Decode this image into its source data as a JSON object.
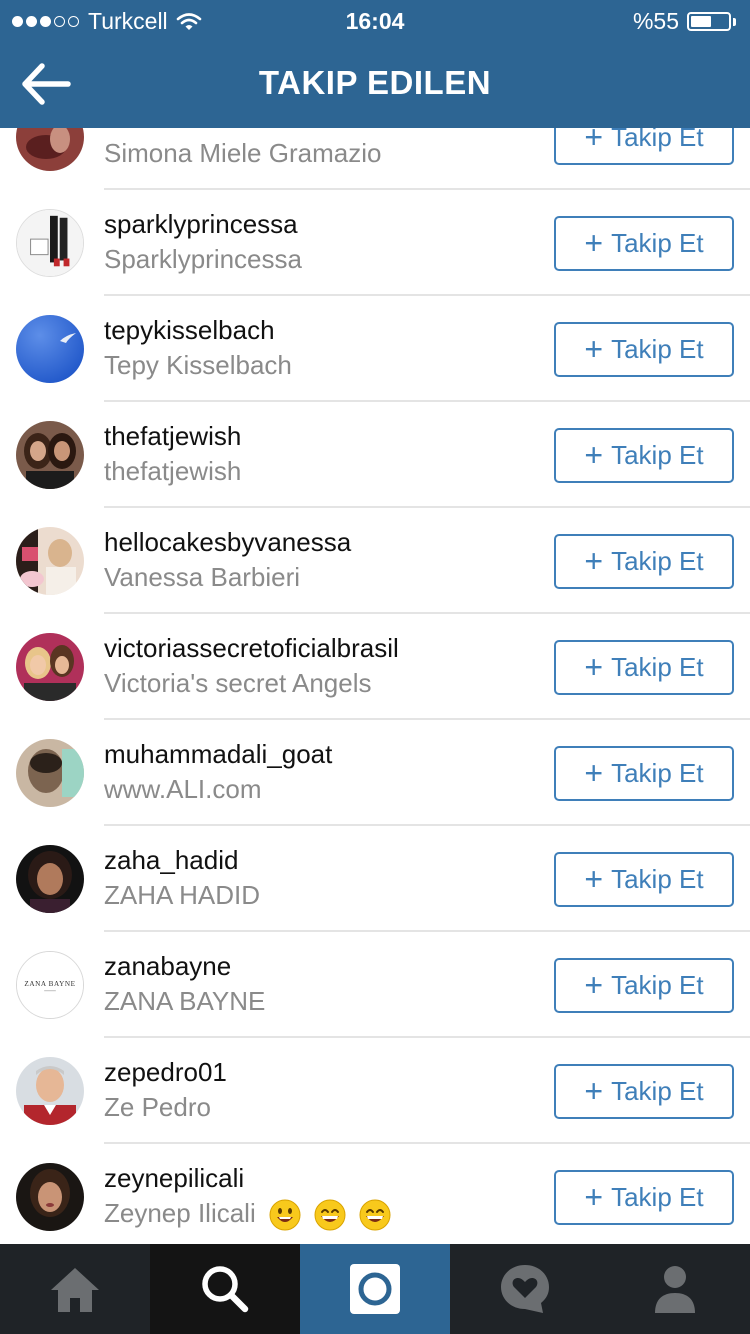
{
  "status_bar": {
    "carrier": "Turkcell",
    "time": "16:04",
    "battery_percent": "%55",
    "signal_bars": 3,
    "battery_level": 0.55
  },
  "nav": {
    "title": "TAKIP EDILEN",
    "back_icon": "back-arrow-icon"
  },
  "follow_label": "Takip Et",
  "follow_plus": "+",
  "colors": {
    "brand": "#2d6593",
    "button": "#3f7fb9",
    "tabbar": "#1f2327"
  },
  "users": [
    {
      "username": "",
      "fullname": "Simona Miele Gramazio"
    },
    {
      "username": "sparklyprincessa",
      "fullname": "Sparklyprincessa"
    },
    {
      "username": "tepykisselbach",
      "fullname": "Tepy Kisselbach"
    },
    {
      "username": "thefatjewish",
      "fullname": "thefatjewish"
    },
    {
      "username": "hellocakesbyvanessa",
      "fullname": "Vanessa Barbieri"
    },
    {
      "username": "victoriassecretoficialbrasil",
      "fullname": "Victoria's secret Angels"
    },
    {
      "username": "muhammadali_goat",
      "fullname": "www.ALI.com"
    },
    {
      "username": "zaha_hadid",
      "fullname": "ZAHA HADID"
    },
    {
      "username": "zanabayne",
      "fullname": "ZANA BAYNE",
      "avatar_text": "ZANA BAYNE"
    },
    {
      "username": "zepedro01",
      "fullname": "Ze Pedro"
    },
    {
      "username": "zeynepilicali",
      "fullname": "Zeynep Ilicali",
      "emoji": [
        "smiley-emoji",
        "grin-emoji",
        "grin-emoji"
      ]
    }
  ],
  "tabs": [
    {
      "name": "home-icon"
    },
    {
      "name": "search-icon",
      "active": true
    },
    {
      "name": "camera-icon"
    },
    {
      "name": "activity-heart-icon"
    },
    {
      "name": "profile-icon"
    }
  ]
}
